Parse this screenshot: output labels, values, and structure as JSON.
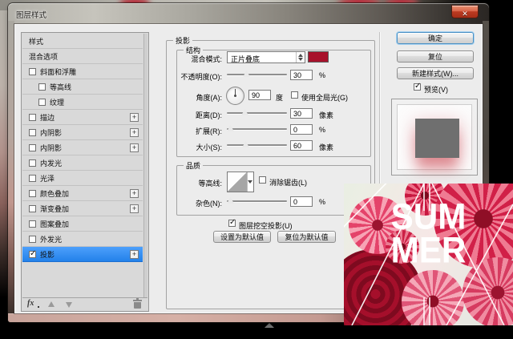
{
  "window": {
    "title": "图层样式",
    "close_glyph": "✕"
  },
  "sidebar": {
    "plus_glyph": "+",
    "items": [
      {
        "label": "样式",
        "checkbox": false,
        "checked": false,
        "plus": false,
        "selected": false
      },
      {
        "label": "混合选项",
        "checkbox": false,
        "checked": false,
        "plus": false,
        "selected": false
      },
      {
        "label": "斜面和浮雕",
        "checkbox": true,
        "checked": false,
        "plus": false,
        "selected": false
      },
      {
        "label": "等高线",
        "checkbox": true,
        "checked": false,
        "plus": false,
        "selected": false,
        "indent": true
      },
      {
        "label": "纹理",
        "checkbox": true,
        "checked": false,
        "plus": false,
        "selected": false,
        "indent": true
      },
      {
        "label": "描边",
        "checkbox": true,
        "checked": false,
        "plus": true,
        "selected": false
      },
      {
        "label": "内阴影",
        "checkbox": true,
        "checked": false,
        "plus": true,
        "selected": false
      },
      {
        "label": "内阴影",
        "checkbox": true,
        "checked": false,
        "plus": true,
        "selected": false
      },
      {
        "label": "内发光",
        "checkbox": true,
        "checked": false,
        "plus": false,
        "selected": false
      },
      {
        "label": "光泽",
        "checkbox": true,
        "checked": false,
        "plus": false,
        "selected": false
      },
      {
        "label": "颜色叠加",
        "checkbox": true,
        "checked": false,
        "plus": true,
        "selected": false
      },
      {
        "label": "渐变叠加",
        "checkbox": true,
        "checked": false,
        "plus": true,
        "selected": false
      },
      {
        "label": "图案叠加",
        "checkbox": true,
        "checked": false,
        "plus": false,
        "selected": false
      },
      {
        "label": "外发光",
        "checkbox": true,
        "checked": false,
        "plus": false,
        "selected": false
      },
      {
        "label": "投影",
        "checkbox": true,
        "checked": true,
        "plus": true,
        "selected": true
      }
    ],
    "footer": {
      "fx_label": "fx"
    }
  },
  "panel": {
    "title": "投影",
    "structure": {
      "title": "结构",
      "blend_mode_label": "混合模式:",
      "blend_mode_value": "正片叠底",
      "swatch_color": "#a8112b",
      "opacity_label": "不透明度(O):",
      "opacity_value": "30",
      "opacity_unit": "%",
      "angle_label": "角度(A):",
      "angle_value": "90",
      "angle_unit": "度",
      "global_light_label": "使用全局光(G)",
      "distance_label": "距离(D):",
      "distance_value": "30",
      "distance_unit": "像素",
      "spread_label": "扩展(R):",
      "spread_value": "0",
      "spread_unit": "%",
      "size_label": "大小(S):",
      "size_value": "60",
      "size_unit": "像素"
    },
    "quality": {
      "title": "品质",
      "contour_label": "等高线:",
      "antialias_label": "消除锯齿(L)",
      "noise_label": "杂色(N):",
      "noise_value": "0",
      "noise_unit": "%"
    },
    "knockout_label": "图层挖空投影(U)",
    "make_default_label": "设置为默认值",
    "reset_default_label": "复位为默认值"
  },
  "actions": {
    "ok": "确定",
    "reset": "复位",
    "new_style": "新建样式(W)...",
    "preview": "预览(V)"
  },
  "artwork": {
    "line1": "SUM",
    "line2": "MER"
  },
  "colors": {
    "shadow_swatch": "#a8112b",
    "selection_blue": "#3b95f7",
    "artwork_crimson": "#d12048",
    "close_button_red": "#bc3b22"
  }
}
